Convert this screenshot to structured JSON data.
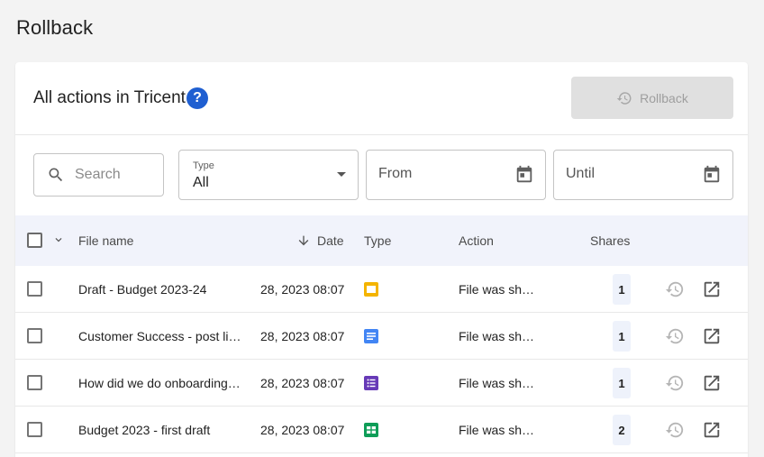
{
  "page": {
    "title": "Rollback"
  },
  "card": {
    "title": "All actions in Tricent",
    "help_icon_glyph": "?",
    "rollback_label": "Rollback"
  },
  "filters": {
    "search_placeholder": "Search",
    "type_label": "Type",
    "type_value": "All",
    "from_placeholder": "From",
    "until_placeholder": "Until"
  },
  "table": {
    "headers": {
      "file_name": "File name",
      "date": "Date",
      "type": "Type",
      "action": "Action",
      "shares": "Shares"
    },
    "rows": [
      {
        "file_name": "Draft - Budget 2023-24",
        "date": "28, 2023 08:07",
        "type_icon": "slides-icon",
        "type_color": "#f4b400",
        "action": "File was sh…",
        "shares": "1"
      },
      {
        "file_name": "Customer Success - post li…",
        "date": "28, 2023 08:07",
        "type_icon": "docs-icon",
        "type_color": "#4285f4",
        "action": "File was sh…",
        "shares": "1"
      },
      {
        "file_name": "How did we do onboarding…",
        "date": "28, 2023 08:07",
        "type_icon": "forms-icon",
        "type_color": "#673ab7",
        "action": "File was sh…",
        "shares": "1"
      },
      {
        "file_name": "Budget 2023 - first draft",
        "date": "28, 2023 08:07",
        "type_icon": "sheets-icon",
        "type_color": "#0f9d58",
        "action": "File was sh…",
        "shares": "2"
      }
    ]
  },
  "colors": {
    "accent": "#1f5fd1",
    "header_bg": "#f1f3fb",
    "disabled_button": "#e0e0e0"
  }
}
